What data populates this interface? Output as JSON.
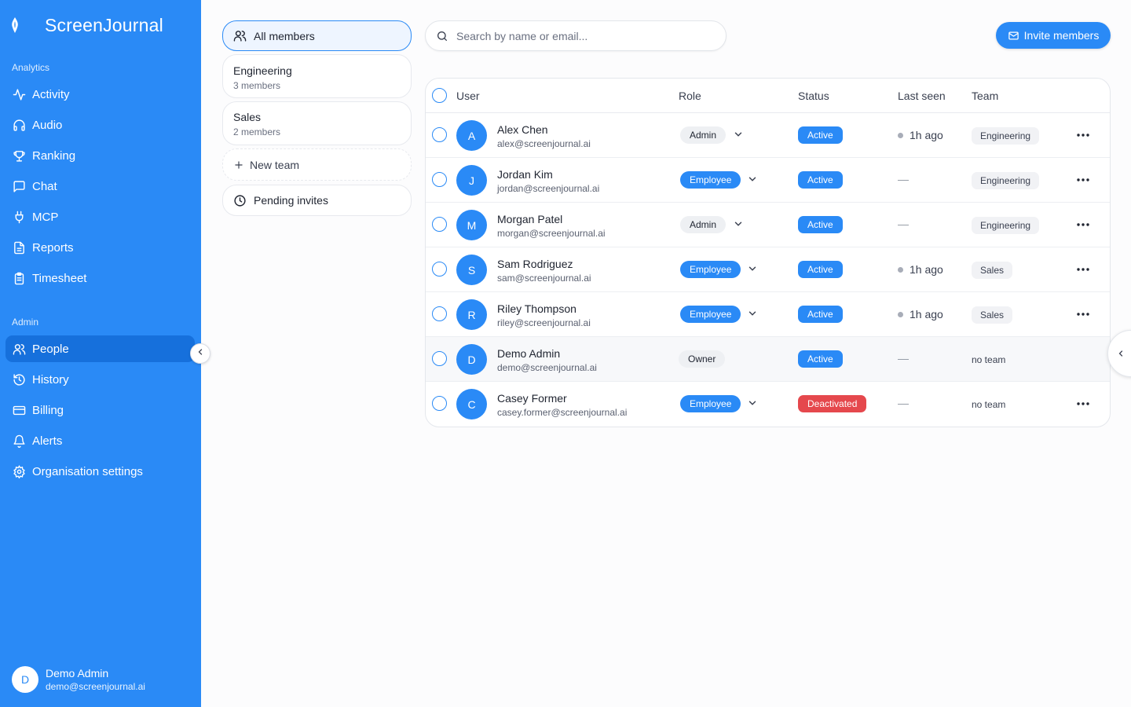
{
  "app": {
    "name": "ScreenJournal"
  },
  "sidebar": {
    "analytics_label": "Analytics",
    "analytics_items": [
      {
        "label": "Activity",
        "icon": "activity-icon"
      },
      {
        "label": "Audio",
        "icon": "headphones-icon"
      },
      {
        "label": "Ranking",
        "icon": "trophy-icon"
      },
      {
        "label": "Chat",
        "icon": "chat-icon"
      },
      {
        "label": "MCP",
        "icon": "plug-icon"
      },
      {
        "label": "Reports",
        "icon": "document-icon"
      },
      {
        "label": "Timesheet",
        "icon": "clipboard-icon"
      }
    ],
    "admin_label": "Admin",
    "admin_items": [
      {
        "label": "People",
        "icon": "users-icon",
        "active": true
      },
      {
        "label": "History",
        "icon": "history-icon"
      },
      {
        "label": "Billing",
        "icon": "credit-card-icon"
      },
      {
        "label": "Alerts",
        "icon": "bell-icon"
      },
      {
        "label": "Organisation settings",
        "icon": "gear-icon"
      }
    ],
    "user": {
      "initial": "D",
      "name": "Demo Admin",
      "email": "demo@screenjournal.ai"
    }
  },
  "teams": {
    "all_members": "All members",
    "list": [
      {
        "name": "Engineering",
        "count": "3 members"
      },
      {
        "name": "Sales",
        "count": "2 members"
      }
    ],
    "new_team": "New team",
    "pending_invites": "Pending invites"
  },
  "search": {
    "placeholder": "Search by name or email..."
  },
  "invite_button": "Invite members",
  "table": {
    "headers": {
      "user": "User",
      "role": "Role",
      "status": "Status",
      "last_seen": "Last seen",
      "team": "Team"
    },
    "rows": [
      {
        "initial": "A",
        "name": "Alex Chen",
        "email": "alex@screenjournal.ai",
        "role": "Admin",
        "status": "Active",
        "last_seen": "1h ago",
        "team": "Engineering"
      },
      {
        "initial": "J",
        "name": "Jordan Kim",
        "email": "jordan@screenjournal.ai",
        "role": "Employee",
        "status": "Active",
        "last_seen": "—",
        "team": "Engineering"
      },
      {
        "initial": "M",
        "name": "Morgan Patel",
        "email": "morgan@screenjournal.ai",
        "role": "Admin",
        "status": "Active",
        "last_seen": "—",
        "team": "Engineering"
      },
      {
        "initial": "S",
        "name": "Sam Rodriguez",
        "email": "sam@screenjournal.ai",
        "role": "Employee",
        "status": "Active",
        "last_seen": "1h ago",
        "team": "Sales"
      },
      {
        "initial": "R",
        "name": "Riley Thompson",
        "email": "riley@screenjournal.ai",
        "role": "Employee",
        "status": "Active",
        "last_seen": "1h ago",
        "team": "Sales"
      },
      {
        "initial": "D",
        "name": "Demo Admin",
        "email": "demo@screenjournal.ai",
        "role": "Owner",
        "status": "Active",
        "last_seen": "—",
        "team": "no team"
      },
      {
        "initial": "C",
        "name": "Casey Former",
        "email": "casey.former@screenjournal.ai",
        "role": "Employee",
        "status": "Deactivated",
        "last_seen": "—",
        "team": "no team"
      }
    ]
  },
  "colors": {
    "brand": "#2a8af6",
    "brand_dark": "#1670dc",
    "danger": "#e5484d"
  }
}
